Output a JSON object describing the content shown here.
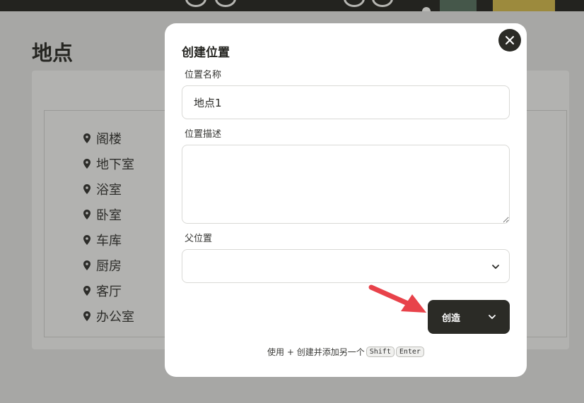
{
  "page": {
    "title": "地点",
    "locations": [
      {
        "label": "阁楼"
      },
      {
        "label": "地下室"
      },
      {
        "label": "浴室"
      },
      {
        "label": "卧室"
      },
      {
        "label": "车库"
      },
      {
        "label": "厨房"
      },
      {
        "label": "客厅"
      },
      {
        "label": "办公室"
      }
    ]
  },
  "modal": {
    "title": "创建位置",
    "name_label": "位置名称",
    "name_value": "地点1",
    "description_label": "位置描述",
    "description_value": "",
    "parent_label": "父位置",
    "parent_value": "",
    "create_label": "创造",
    "hint_prefix": "使用 + 创建并添加另一个",
    "hint_key_1": "Shift",
    "hint_key_2": "Enter"
  },
  "colors": {
    "overlay": "#a7a7a5",
    "modal_bg": "#ffffff",
    "button_dark": "#2b2b26",
    "arrow": "#e8424a"
  },
  "icons": {
    "close": "close-icon",
    "location_pin": "map-pin-icon",
    "select_chevron": "chevron-down-icon",
    "create_menu": "chevron-down-icon",
    "annotation_arrow": "arrow-icon"
  }
}
